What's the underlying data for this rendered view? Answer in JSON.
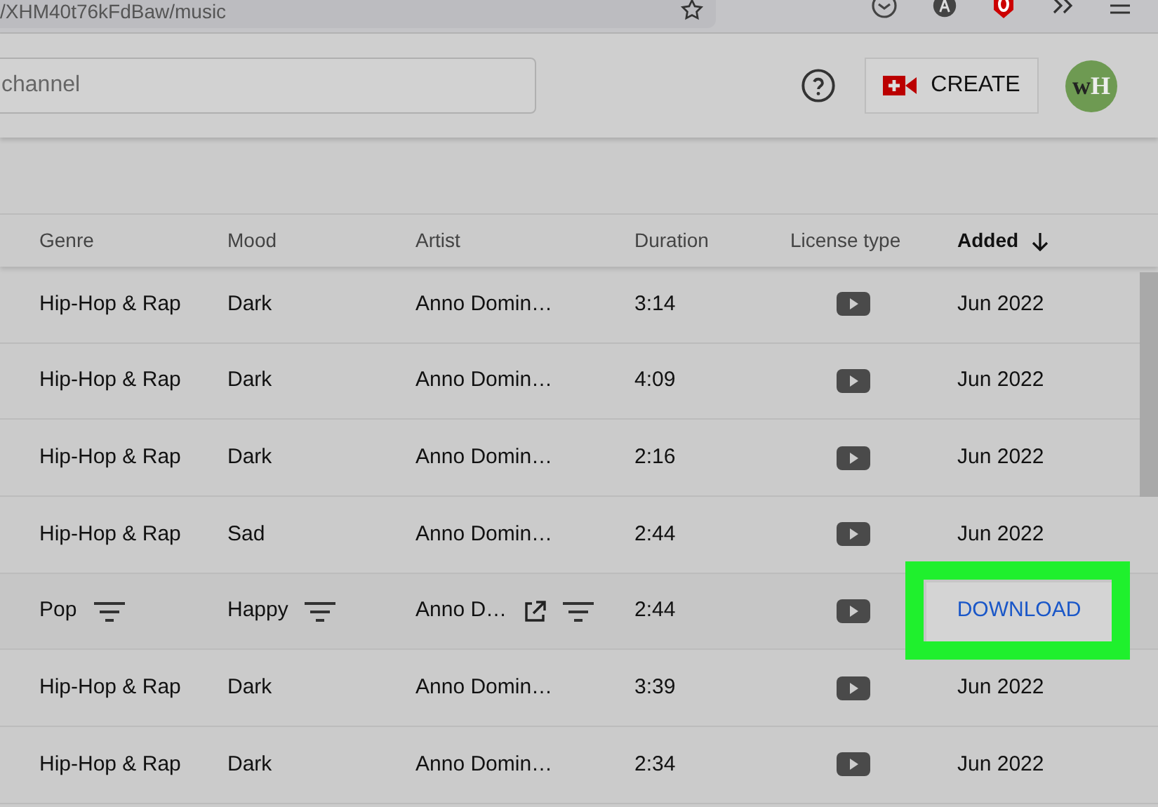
{
  "browser": {
    "url": "/XHM40t76kFdBaw/music"
  },
  "header": {
    "search_placeholder": "channel",
    "create_label": "CREATE",
    "avatar_text": "wH"
  },
  "table": {
    "columns": [
      {
        "label": "Genre",
        "sorted": false
      },
      {
        "label": "Mood",
        "sorted": false
      },
      {
        "label": "Artist",
        "sorted": false
      },
      {
        "label": "Duration",
        "sorted": false
      },
      {
        "label": "License type",
        "sorted": false
      },
      {
        "label": "Added",
        "sorted": true
      }
    ],
    "rows": [
      {
        "genre": "Hip-Hop & Rap",
        "mood": "Dark",
        "artist": "Anno Domin…",
        "duration": "3:14",
        "added": "Jun 2022",
        "hovered": false
      },
      {
        "genre": "Hip-Hop & Rap",
        "mood": "Dark",
        "artist": "Anno Domin…",
        "duration": "4:09",
        "added": "Jun 2022",
        "hovered": false
      },
      {
        "genre": "Hip-Hop & Rap",
        "mood": "Dark",
        "artist": "Anno Domin…",
        "duration": "2:16",
        "added": "Jun 2022",
        "hovered": false
      },
      {
        "genre": "Hip-Hop & Rap",
        "mood": "Sad",
        "artist": "Anno Domin…",
        "duration": "2:44",
        "added": "Jun 2022",
        "hovered": false
      },
      {
        "genre": "Pop",
        "mood": "Happy",
        "artist": "Anno D…",
        "duration": "2:44",
        "download_label": "DOWNLOAD",
        "hovered": true
      },
      {
        "genre": "Hip-Hop & Rap",
        "mood": "Dark",
        "artist": "Anno Domin…",
        "duration": "3:39",
        "added": "Jun 2022",
        "hovered": false
      },
      {
        "genre": "Hip-Hop & Rap",
        "mood": "Dark",
        "artist": "Anno Domin…",
        "duration": "2:34",
        "added": "Jun 2022",
        "hovered": false
      }
    ]
  }
}
